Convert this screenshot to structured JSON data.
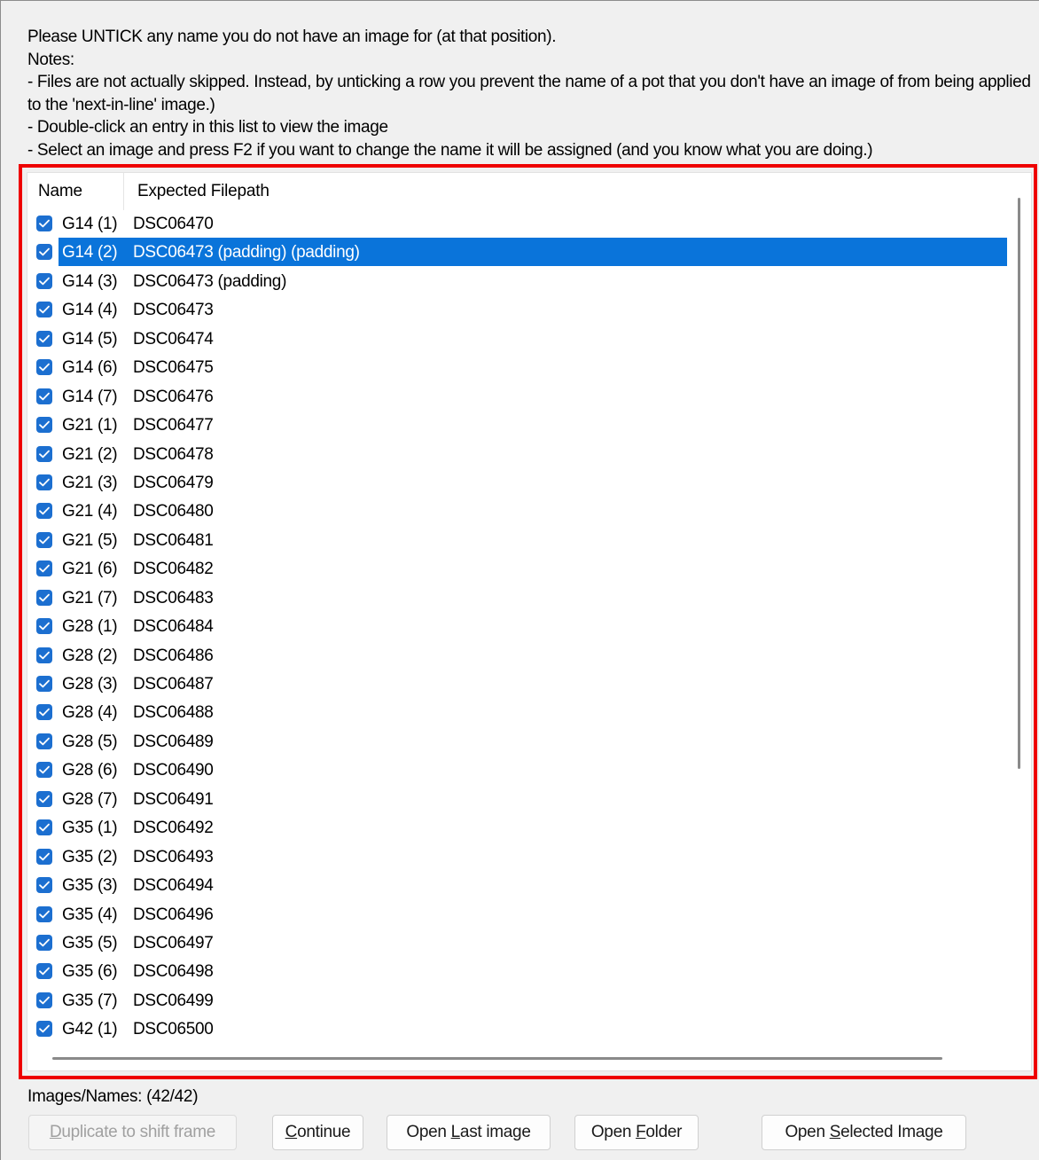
{
  "instructions": {
    "line1": "Please UNTICK any name you do not have an image for (at that position).",
    "line2": "Notes:",
    "line3": " - Files are not actually skipped. Instead, by unticking a row you prevent the name of a pot that you don't have an image of from being applied to the 'next-in-line' image.)",
    "line4": " - Double-click an entry in this list to view the image",
    "line5": " - Select an image and press F2 if you want to change the name it will be assigned (and you know what you are doing.)"
  },
  "list": {
    "columns": {
      "name": "Name",
      "path": "Expected Filepath"
    },
    "rows": [
      {
        "name": "G14 (1)",
        "path": "DSC06470",
        "checked": true,
        "selected": false
      },
      {
        "name": "G14 (2)",
        "path": "DSC06473 (padding) (padding)",
        "checked": true,
        "selected": true
      },
      {
        "name": "G14 (3)",
        "path": "DSC06473 (padding)",
        "checked": true,
        "selected": false
      },
      {
        "name": "G14 (4)",
        "path": "DSC06473",
        "checked": true,
        "selected": false
      },
      {
        "name": "G14 (5)",
        "path": "DSC06474",
        "checked": true,
        "selected": false
      },
      {
        "name": "G14 (6)",
        "path": "DSC06475",
        "checked": true,
        "selected": false
      },
      {
        "name": "G14 (7)",
        "path": "DSC06476",
        "checked": true,
        "selected": false
      },
      {
        "name": "G21 (1)",
        "path": "DSC06477",
        "checked": true,
        "selected": false
      },
      {
        "name": "G21 (2)",
        "path": "DSC06478",
        "checked": true,
        "selected": false
      },
      {
        "name": "G21 (3)",
        "path": "DSC06479",
        "checked": true,
        "selected": false
      },
      {
        "name": "G21 (4)",
        "path": "DSC06480",
        "checked": true,
        "selected": false
      },
      {
        "name": "G21 (5)",
        "path": "DSC06481",
        "checked": true,
        "selected": false
      },
      {
        "name": "G21 (6)",
        "path": "DSC06482",
        "checked": true,
        "selected": false
      },
      {
        "name": "G21 (7)",
        "path": "DSC06483",
        "checked": true,
        "selected": false
      },
      {
        "name": "G28 (1)",
        "path": "DSC06484",
        "checked": true,
        "selected": false
      },
      {
        "name": "G28 (2)",
        "path": "DSC06486",
        "checked": true,
        "selected": false
      },
      {
        "name": "G28 (3)",
        "path": "DSC06487",
        "checked": true,
        "selected": false
      },
      {
        "name": "G28 (4)",
        "path": "DSC06488",
        "checked": true,
        "selected": false
      },
      {
        "name": "G28 (5)",
        "path": "DSC06489",
        "checked": true,
        "selected": false
      },
      {
        "name": "G28 (6)",
        "path": "DSC06490",
        "checked": true,
        "selected": false
      },
      {
        "name": "G28 (7)",
        "path": "DSC06491",
        "checked": true,
        "selected": false
      },
      {
        "name": "G35 (1)",
        "path": "DSC06492",
        "checked": true,
        "selected": false
      },
      {
        "name": "G35 (2)",
        "path": "DSC06493",
        "checked": true,
        "selected": false
      },
      {
        "name": "G35 (3)",
        "path": "DSC06494",
        "checked": true,
        "selected": false
      },
      {
        "name": "G35 (4)",
        "path": "DSC06496",
        "checked": true,
        "selected": false
      },
      {
        "name": "G35 (5)",
        "path": "DSC06497",
        "checked": true,
        "selected": false
      },
      {
        "name": "G35 (6)",
        "path": "DSC06498",
        "checked": true,
        "selected": false
      },
      {
        "name": "G35 (7)",
        "path": "DSC06499",
        "checked": true,
        "selected": false
      },
      {
        "name": "G42 (1)",
        "path": "DSC06500",
        "checked": true,
        "selected": false
      }
    ]
  },
  "status": {
    "count_label": "Images/Names: (42/42)"
  },
  "buttons": {
    "duplicate": {
      "pre": "",
      "accel": "D",
      "post": "uplicate to shift frame",
      "enabled": false
    },
    "continue": {
      "pre": "",
      "accel": "C",
      "post": "ontinue",
      "enabled": true
    },
    "open_last": {
      "pre": "Open ",
      "accel": "L",
      "post": "ast image",
      "enabled": true
    },
    "open_folder": {
      "pre": "Open ",
      "accel": "F",
      "post": "older",
      "enabled": true
    },
    "open_selected": {
      "pre": "Open ",
      "accel": "S",
      "post": "elected Image",
      "enabled": true
    }
  },
  "colors": {
    "highlight_border": "#ee0000",
    "selection": "#0a74da",
    "checkbox": "#1c6fd0"
  },
  "icons": {
    "checkbox": "checkmark-icon"
  }
}
